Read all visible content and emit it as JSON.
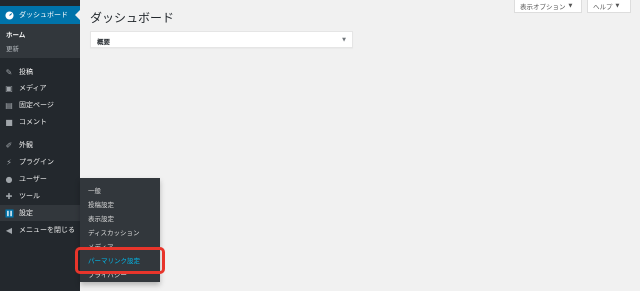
{
  "sidebar": {
    "dashboard_label": "ダッシュボード",
    "dashboard_sub": [
      "ホーム",
      "更新"
    ],
    "items": [
      {
        "label": "投稿",
        "icon": "pin-icon"
      },
      {
        "label": "メディア",
        "icon": "media-icon"
      },
      {
        "label": "固定ページ",
        "icon": "page-icon"
      },
      {
        "label": "コメント",
        "icon": "comment-icon"
      },
      {
        "label": "外観",
        "icon": "brush-icon"
      },
      {
        "label": "プラグイン",
        "icon": "plugin-icon"
      },
      {
        "label": "ユーザー",
        "icon": "user-icon"
      },
      {
        "label": "ツール",
        "icon": "wrench-icon"
      },
      {
        "label": "設定",
        "icon": "settings-icon"
      },
      {
        "label": "メニューを閉じる",
        "icon": "collapse-icon"
      }
    ]
  },
  "flyout": {
    "items": [
      "一般",
      "投稿設定",
      "表示設定",
      "ディスカッション",
      "メディア",
      "パーマリンク設定",
      "プライバシー"
    ]
  },
  "header": {
    "screen_options": "表示オプション",
    "help": "ヘルプ"
  },
  "main": {
    "title": "ダッシュボード",
    "postbox_title": "概要"
  },
  "colors": {
    "sidebar_bg": "#23282d",
    "accent": "#0073aa",
    "flyout_active": "#00b9eb",
    "highlight": "#e8352b"
  }
}
